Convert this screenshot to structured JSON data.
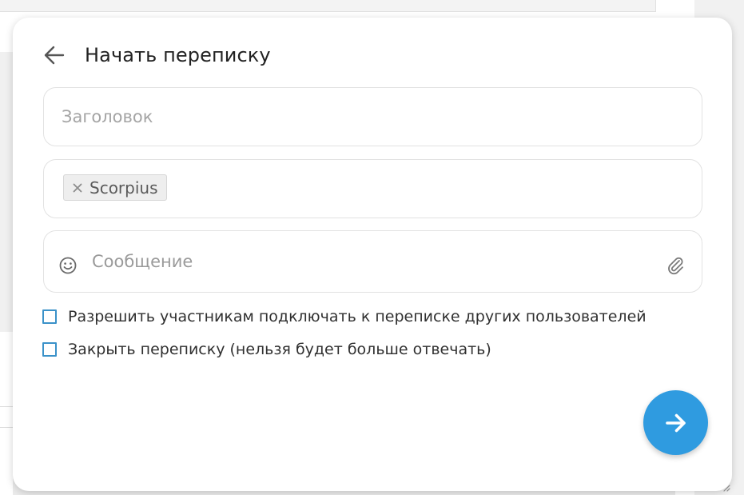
{
  "modal": {
    "title": "Начать переписку",
    "back_icon": "arrow-left-icon"
  },
  "subject": {
    "placeholder": "Заголовок",
    "value": ""
  },
  "recipients": {
    "tags": [
      {
        "label": "Scorpius",
        "remove_icon": "close-icon"
      }
    ]
  },
  "message": {
    "placeholder": "Сообщение",
    "value": "",
    "emoji_icon": "smiley-icon",
    "attach_icon": "paperclip-icon"
  },
  "options": [
    {
      "label": "Разрешить участникам подключать к переписке других пользователей",
      "checked": false
    },
    {
      "label": "Закрыть переписку (нельзя будет больше отвечать)",
      "checked": false
    }
  ],
  "send_button": {
    "icon": "arrow-right-icon"
  },
  "colors": {
    "accent": "#2f9be0",
    "checkbox_border": "#3b92c9",
    "text": "#222222",
    "placeholder": "#a4a4a4"
  }
}
